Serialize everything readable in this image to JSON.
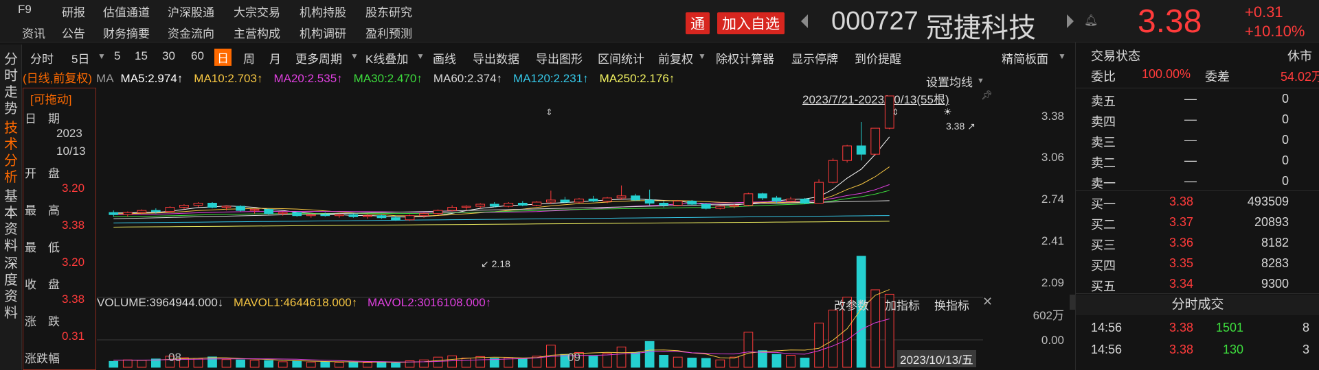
{
  "top_nav": {
    "row1": [
      "F9",
      "研报",
      "估值通道",
      "沪深股通",
      "大宗交易",
      "机构持股",
      "股东研究"
    ],
    "row2": [
      "资讯",
      "公告",
      "财务摘要",
      "资金流向",
      "主营构成",
      "机构调研",
      "盈利预测"
    ]
  },
  "stock": {
    "tong_badge": "通",
    "add_watch": "加入自选",
    "code": "000727",
    "name": "冠捷科技",
    "price": "3.38",
    "change": "+0.31",
    "change_pct": "+10.10%",
    "colors": {
      "up": "#ff3b3b",
      "down": "#25d0d0",
      "accent": "#ff6a00"
    }
  },
  "side_tabs": [
    "分时走势",
    "技术分析",
    "基本资料",
    "深度资料"
  ],
  "toolbar": {
    "items": [
      "分时",
      "5日",
      "5",
      "15",
      "30",
      "60",
      "日",
      "周",
      "月",
      "更多周期",
      "K线叠加",
      "画线",
      "导出数据",
      "导出图形",
      "区间统计",
      "前复权",
      "除权计算器",
      "显示停牌",
      "到价提醒"
    ],
    "active": "日",
    "simple_panel": "精简板面"
  },
  "ma_legend": {
    "period_label": "(日线,前复权)",
    "ma": "MA",
    "items": [
      {
        "text": "MA5:2.974↑",
        "color": "#ffffff"
      },
      {
        "text": "MA10:2.703↑",
        "color": "#f5c542"
      },
      {
        "text": "MA20:2.535↑",
        "color": "#e040e0"
      },
      {
        "text": "MA30:2.470↑",
        "color": "#3ddc3d"
      },
      {
        "text": "MA60:2.374↑",
        "color": "#d8d8d8"
      },
      {
        "text": "MA120:2.231↑",
        "color": "#35c8e8"
      },
      {
        "text": "MA250:2.176↑",
        "color": "#f0f060"
      }
    ],
    "set_ma": "设置均线",
    "range": "2023/7/21-2023/10/13(55根)"
  },
  "info_box": {
    "draggable": "[可拖动]",
    "date_label": "日　期",
    "date_year": "2023",
    "date_md": "10/13",
    "open_label": "开　盘",
    "open": "3.20",
    "high_label": "最　高",
    "high": "3.38",
    "low_label": "最　低",
    "low": "3.20",
    "close_label": "收　盘",
    "close": "3.38",
    "chg_label": "涨　跌",
    "chg": "0.31",
    "chg_pct_label": "涨跌幅"
  },
  "price_axis": [
    "3.38",
    "3.06",
    "2.74",
    "2.41",
    "2.09"
  ],
  "annotations": {
    "high": "3.38",
    "low": "2.18"
  },
  "volume": {
    "vol": "VOLUME:3964944.000↓",
    "mavol1": "MAVOL1:4644618.000↑",
    "mavol2": "MAVOL2:3016108.000↑",
    "change_param": "改参数",
    "add_indicator": "加指标",
    "swap_indicator": "换指标",
    "axis_top": "602万",
    "axis_bottom": "0.00"
  },
  "x_axis": {
    "labels": [
      "08",
      "09"
    ],
    "cursor_date": "2023/10/13/五"
  },
  "chart_data": {
    "type": "candlestick",
    "ylim": [
      2.09,
      3.38
    ],
    "candles": [
      [
        2.26,
        2.28,
        2.22,
        2.24
      ],
      [
        2.24,
        2.27,
        2.22,
        2.26
      ],
      [
        2.26,
        2.29,
        2.24,
        2.28
      ],
      [
        2.28,
        2.3,
        2.25,
        2.27
      ],
      [
        2.27,
        2.32,
        2.26,
        2.31
      ],
      [
        2.31,
        2.34,
        2.29,
        2.33
      ],
      [
        2.33,
        2.36,
        2.31,
        2.35
      ],
      [
        2.35,
        2.36,
        2.3,
        2.31
      ],
      [
        2.31,
        2.33,
        2.28,
        2.32
      ],
      [
        2.32,
        2.33,
        2.27,
        2.28
      ],
      [
        2.28,
        2.3,
        2.25,
        2.29
      ],
      [
        2.29,
        2.3,
        2.24,
        2.25
      ],
      [
        2.25,
        2.27,
        2.23,
        2.26
      ],
      [
        2.26,
        2.27,
        2.22,
        2.23
      ],
      [
        2.23,
        2.25,
        2.21,
        2.24
      ],
      [
        2.24,
        2.26,
        2.22,
        2.23
      ],
      [
        2.23,
        2.25,
        2.21,
        2.24
      ],
      [
        2.24,
        2.25,
        2.21,
        2.22
      ],
      [
        2.22,
        2.24,
        2.2,
        2.23
      ],
      [
        2.23,
        2.24,
        2.2,
        2.21
      ],
      [
        2.21,
        2.23,
        2.18,
        2.19
      ],
      [
        2.19,
        2.24,
        2.18,
        2.23
      ],
      [
        2.23,
        2.26,
        2.21,
        2.25
      ],
      [
        2.25,
        2.29,
        2.24,
        2.28
      ],
      [
        2.28,
        2.33,
        2.27,
        2.31
      ],
      [
        2.31,
        2.33,
        2.28,
        2.32
      ],
      [
        2.32,
        2.35,
        2.3,
        2.34
      ],
      [
        2.34,
        2.36,
        2.31,
        2.32
      ],
      [
        2.32,
        2.36,
        2.31,
        2.35
      ],
      [
        2.35,
        2.37,
        2.32,
        2.33
      ],
      [
        2.33,
        2.37,
        2.32,
        2.36
      ],
      [
        2.36,
        2.47,
        2.34,
        2.38
      ],
      [
        2.38,
        2.41,
        2.35,
        2.36
      ],
      [
        2.36,
        2.4,
        2.35,
        2.39
      ],
      [
        2.39,
        2.42,
        2.36,
        2.37
      ],
      [
        2.37,
        2.41,
        2.35,
        2.4
      ],
      [
        2.4,
        2.52,
        2.38,
        2.42
      ],
      [
        2.42,
        2.44,
        2.37,
        2.38
      ],
      [
        2.38,
        2.48,
        2.33,
        2.35
      ],
      [
        2.35,
        2.37,
        2.31,
        2.33
      ],
      [
        2.33,
        2.38,
        2.32,
        2.37
      ],
      [
        2.37,
        2.38,
        2.33,
        2.34
      ],
      [
        2.34,
        2.35,
        2.29,
        2.3
      ],
      [
        2.3,
        2.33,
        2.29,
        2.32
      ],
      [
        2.32,
        2.34,
        2.3,
        2.33
      ],
      [
        2.33,
        2.45,
        2.32,
        2.44
      ],
      [
        2.44,
        2.45,
        2.38,
        2.4
      ],
      [
        2.4,
        2.42,
        2.35,
        2.37
      ],
      [
        2.37,
        2.41,
        2.36,
        2.39
      ],
      [
        2.39,
        2.4,
        2.34,
        2.35
      ],
      [
        2.35,
        2.58,
        2.35,
        2.55
      ],
      [
        2.55,
        2.78,
        2.54,
        2.76
      ],
      [
        2.76,
        2.91,
        2.74,
        2.9
      ],
      [
        2.9,
        3.13,
        2.76,
        2.82
      ],
      [
        2.82,
        3.07,
        2.81,
        3.07
      ],
      [
        3.07,
        3.38,
        3.06,
        3.38
      ]
    ],
    "volumes_wan": [
      32,
      40,
      38,
      45,
      60,
      52,
      48,
      56,
      42,
      40,
      38,
      36,
      30,
      35,
      28,
      30,
      26,
      28,
      25,
      30,
      22,
      35,
      40,
      55,
      62,
      50,
      58,
      48,
      52,
      45,
      60,
      120,
      70,
      80,
      60,
      75,
      110,
      80,
      140,
      65,
      55,
      50,
      48,
      40,
      55,
      190,
      90,
      70,
      65,
      50,
      240,
      310,
      380,
      602,
      420,
      396
    ]
  },
  "right_panel": {
    "trade_status_label": "交易状态",
    "trade_status": "休市",
    "ratio_label": "委比",
    "ratio": "100.00%",
    "diff_label": "委差",
    "diff": "54.02万",
    "asks": [
      {
        "label": "卖五",
        "price": "—",
        "vol": "0"
      },
      {
        "label": "卖四",
        "price": "—",
        "vol": "0"
      },
      {
        "label": "卖三",
        "price": "—",
        "vol": "0"
      },
      {
        "label": "卖二",
        "price": "—",
        "vol": "0"
      },
      {
        "label": "卖一",
        "price": "—",
        "vol": "0"
      }
    ],
    "bids": [
      {
        "label": "买一",
        "price": "3.38",
        "vol": "493509"
      },
      {
        "label": "买二",
        "price": "3.37",
        "vol": "20893"
      },
      {
        "label": "买三",
        "price": "3.36",
        "vol": "8182"
      },
      {
        "label": "买四",
        "price": "3.35",
        "vol": "8283"
      },
      {
        "label": "买五",
        "price": "3.34",
        "vol": "9300"
      }
    ],
    "ticks_title": "分时成交",
    "ticks": [
      {
        "time": "14:56",
        "price": "3.38",
        "vol": "1501",
        "n": "8"
      },
      {
        "time": "14:56",
        "price": "3.38",
        "vol": "130",
        "n": "3"
      }
    ]
  }
}
